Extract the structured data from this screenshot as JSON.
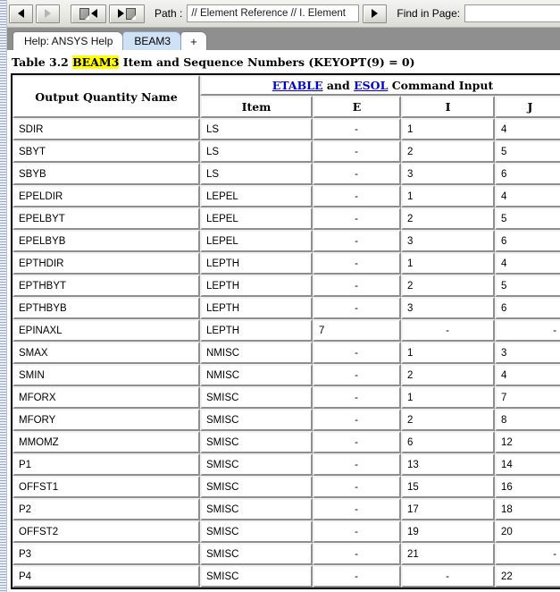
{
  "toolbar": {
    "back_button": "back-arrow",
    "forward_button": "forward-arrow-disabled",
    "prev_page_button": "previous-page",
    "next_page_button": "next-page",
    "path_label": "Path :",
    "path_value": "// Element Reference // I. Element ",
    "path_go_button": "go-arrow",
    "find_label": "Find in Page:",
    "find_value": "",
    "find_placeholder": ""
  },
  "tabs": [
    {
      "label": "Help: ANSYS Help",
      "active": false
    },
    {
      "label": "BEAM3",
      "active": true
    },
    {
      "label": "+",
      "active": false
    }
  ],
  "document": {
    "title_prefix": "Table 3.2 ",
    "title_highlight": "BEAM3",
    "title_suffix": " Item and Sequence Numbers (KEYOPT(9) = 0)",
    "highlight_color": "#ffff00"
  },
  "table": {
    "header": {
      "name_column": "Output Quantity Name",
      "command_group_pre": "",
      "command_link_1": "ETABLE",
      "command_group_mid": " and ",
      "command_link_2": "ESOL",
      "command_group_post": " Command Input",
      "sub_columns": [
        "Item",
        "E",
        "I",
        "J"
      ]
    },
    "rows": [
      {
        "name": "SDIR",
        "item": "LS",
        "e": "-",
        "i": "1",
        "j": "4",
        "e_align": "ctr",
        "i_align": "left",
        "j_align": "left"
      },
      {
        "name": "SBYT",
        "item": "LS",
        "e": "-",
        "i": "2",
        "j": "5",
        "e_align": "ctr",
        "i_align": "left",
        "j_align": "left"
      },
      {
        "name": "SBYB",
        "item": "LS",
        "e": "-",
        "i": "3",
        "j": "6",
        "e_align": "ctr",
        "i_align": "left",
        "j_align": "left"
      },
      {
        "name": "EPELDIR",
        "item": "LEPEL",
        "e": "-",
        "i": "1",
        "j": "4",
        "e_align": "ctr",
        "i_align": "left",
        "j_align": "left"
      },
      {
        "name": "EPELBYT",
        "item": "LEPEL",
        "e": "-",
        "i": "2",
        "j": "5",
        "e_align": "ctr",
        "i_align": "left",
        "j_align": "left"
      },
      {
        "name": "EPELBYB",
        "item": "LEPEL",
        "e": "-",
        "i": "3",
        "j": "6",
        "e_align": "ctr",
        "i_align": "left",
        "j_align": "left"
      },
      {
        "name": "EPTHDIR",
        "item": "LEPTH",
        "e": "-",
        "i": "1",
        "j": "4",
        "e_align": "ctr",
        "i_align": "left",
        "j_align": "left"
      },
      {
        "name": "EPTHBYT",
        "item": "LEPTH",
        "e": "-",
        "i": "2",
        "j": "5",
        "e_align": "ctr",
        "i_align": "left",
        "j_align": "left"
      },
      {
        "name": "EPTHBYB",
        "item": "LEPTH",
        "e": "-",
        "i": "3",
        "j": "6",
        "e_align": "ctr",
        "i_align": "left",
        "j_align": "left"
      },
      {
        "name": "EPINAXL",
        "item": "LEPTH",
        "e": "7",
        "i": "-",
        "j": "-",
        "e_align": "left",
        "i_align": "ctr",
        "j_align": "rt"
      },
      {
        "name": "SMAX",
        "item": "NMISC",
        "e": "-",
        "i": "1",
        "j": "3",
        "e_align": "ctr",
        "i_align": "left",
        "j_align": "left"
      },
      {
        "name": "SMIN",
        "item": "NMISC",
        "e": "-",
        "i": "2",
        "j": "4",
        "e_align": "ctr",
        "i_align": "left",
        "j_align": "left"
      },
      {
        "name": "MFORX",
        "item": "SMISC",
        "e": "-",
        "i": "1",
        "j": "7",
        "e_align": "ctr",
        "i_align": "left",
        "j_align": "left"
      },
      {
        "name": "MFORY",
        "item": "SMISC",
        "e": "-",
        "i": "2",
        "j": "8",
        "e_align": "ctr",
        "i_align": "left",
        "j_align": "left"
      },
      {
        "name": "MMOMZ",
        "item": "SMISC",
        "e": "-",
        "i": "6",
        "j": "12",
        "e_align": "ctr",
        "i_align": "left",
        "j_align": "left"
      },
      {
        "name": "P1",
        "item": "SMISC",
        "e": "-",
        "i": "13",
        "j": "14",
        "e_align": "ctr",
        "i_align": "left",
        "j_align": "left"
      },
      {
        "name": "OFFST1",
        "item": "SMISC",
        "e": "-",
        "i": "15",
        "j": "16",
        "e_align": "ctr",
        "i_align": "left",
        "j_align": "left"
      },
      {
        "name": "P2",
        "item": "SMISC",
        "e": "-",
        "i": "17",
        "j": "18",
        "e_align": "ctr",
        "i_align": "left",
        "j_align": "left"
      },
      {
        "name": "OFFST2",
        "item": "SMISC",
        "e": "-",
        "i": "19",
        "j": "20",
        "e_align": "ctr",
        "i_align": "left",
        "j_align": "left"
      },
      {
        "name": "P3",
        "item": "SMISC",
        "e": "-",
        "i": "21",
        "j": "-",
        "e_align": "ctr",
        "i_align": "left",
        "j_align": "rt"
      },
      {
        "name": "P4",
        "item": "SMISC",
        "e": "-",
        "i": "-",
        "j": "22",
        "e_align": "ctr",
        "i_align": "ctr",
        "j_align": "left"
      }
    ]
  }
}
